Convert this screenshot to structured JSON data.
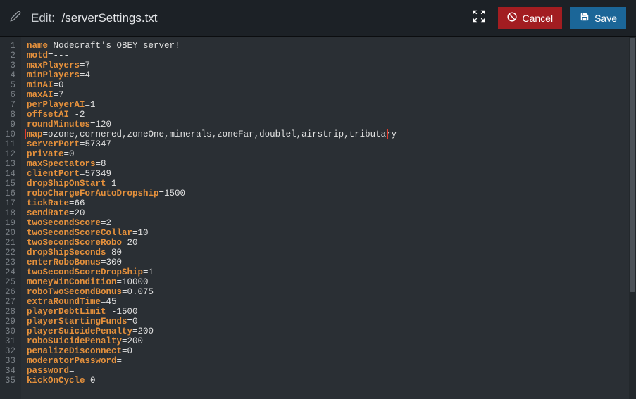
{
  "header": {
    "editLabel": "Edit:",
    "filePath": "/serverSettings.txt",
    "cancelLabel": "Cancel",
    "saveLabel": "Save"
  },
  "highlightLine": 10,
  "lines": [
    {
      "key": "name",
      "value": "Nodecraft's OBEY server!"
    },
    {
      "key": "motd",
      "value": "---"
    },
    {
      "key": "maxPlayers",
      "value": "7"
    },
    {
      "key": "minPlayers",
      "value": "4"
    },
    {
      "key": "minAI",
      "value": "0"
    },
    {
      "key": "maxAI",
      "value": "7"
    },
    {
      "key": "perPlayerAI",
      "value": "1"
    },
    {
      "key": "offsetAI",
      "value": "-2"
    },
    {
      "key": "roundMinutes",
      "value": "120"
    },
    {
      "key": "map",
      "value": "ozone,cornered,zoneOne,minerals,zoneFar,doublel,airstrip,tributary"
    },
    {
      "key": "serverPort",
      "value": "57347"
    },
    {
      "key": "private",
      "value": "0"
    },
    {
      "key": "maxSpectators",
      "value": "8"
    },
    {
      "key": "clientPort",
      "value": "57349"
    },
    {
      "key": "dropShipOnStart",
      "value": "1"
    },
    {
      "key": "roboChargeForAutoDropship",
      "value": "1500"
    },
    {
      "key": "tickRate",
      "value": "66"
    },
    {
      "key": "sendRate",
      "value": "20"
    },
    {
      "key": "twoSecondScore",
      "value": "2"
    },
    {
      "key": "twoSecondScoreCollar",
      "value": "10"
    },
    {
      "key": "twoSecondScoreRobo",
      "value": "20"
    },
    {
      "key": "dropShipSeconds",
      "value": "80"
    },
    {
      "key": "enterRoboBonus",
      "value": "300"
    },
    {
      "key": "twoSecondScoreDropShip",
      "value": "1"
    },
    {
      "key": "moneyWinCondition",
      "value": "10000"
    },
    {
      "key": "roboTwoSecondBonus",
      "value": "0.075"
    },
    {
      "key": "extraRoundTime",
      "value": "45"
    },
    {
      "key": "playerDebtLimit",
      "value": "-1500"
    },
    {
      "key": "playerStartingFunds",
      "value": "0"
    },
    {
      "key": "playerSuicidePenalty",
      "value": "200"
    },
    {
      "key": "roboSuicidePenalty",
      "value": "200"
    },
    {
      "key": "penalizeDisconnect",
      "value": "0"
    },
    {
      "key": "moderatorPassword",
      "value": ""
    },
    {
      "key": "password",
      "value": ""
    },
    {
      "key": "kickOnCycle",
      "value": "0"
    }
  ]
}
